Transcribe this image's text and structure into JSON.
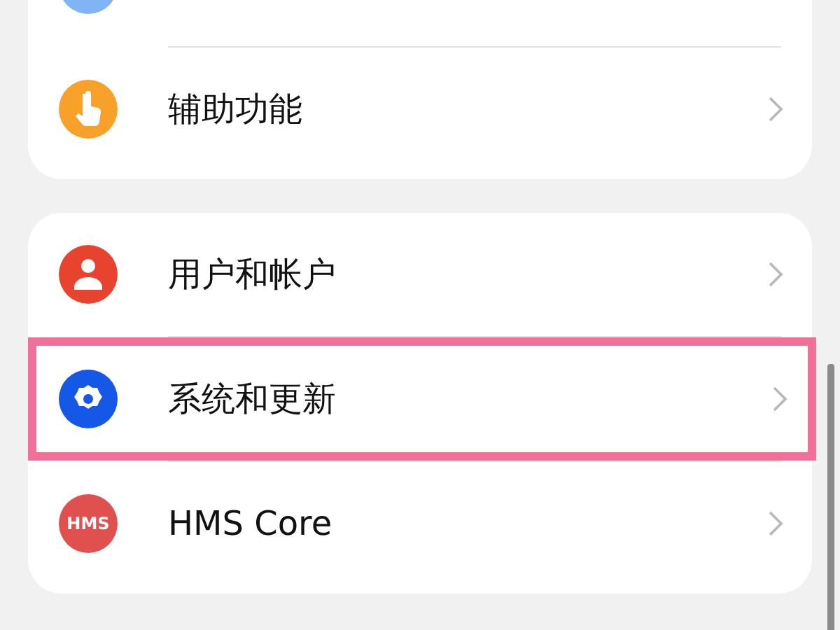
{
  "groups": [
    {
      "items": [
        {
          "kind": "blue-circle"
        },
        {
          "kind": "accessibility",
          "label": "辅助功能",
          "highlighted": false
        }
      ]
    },
    {
      "items": [
        {
          "kind": "user",
          "label": "用户和帐户",
          "highlighted": false
        },
        {
          "kind": "settings",
          "label": "系统和更新",
          "highlighted": true
        },
        {
          "kind": "hms",
          "icon_text": "HMS",
          "label": "HMS Core",
          "highlighted": false
        }
      ]
    }
  ]
}
